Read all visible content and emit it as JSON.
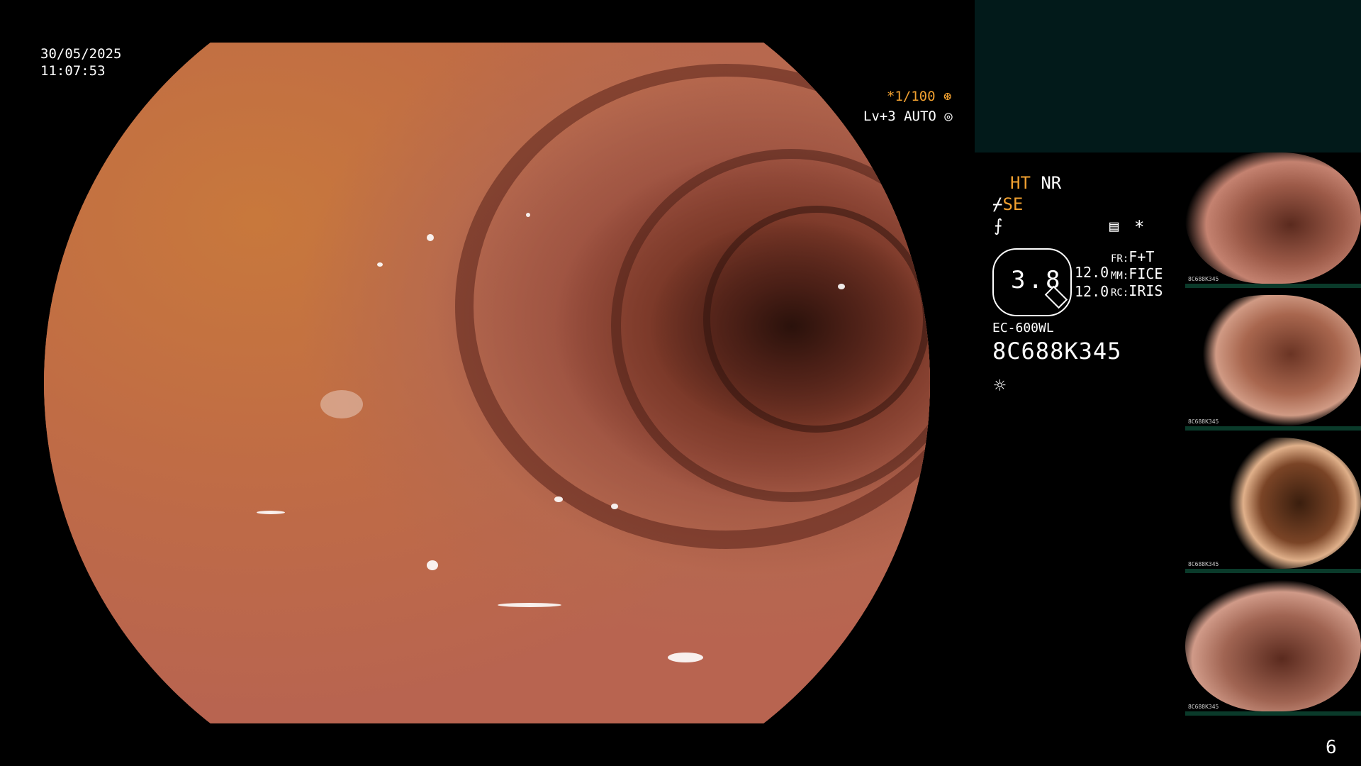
{
  "overlay": {
    "date": "30/05/2025",
    "time": "11:07:53",
    "shutter": "*1/100",
    "shutter_icon": "aperture-icon",
    "level": "Lv+3 AUTO",
    "level_icon": "iris-icon"
  },
  "panel": {
    "ht": "HT",
    "nr": "NR",
    "se": "SE",
    "se_icon": "structure-enhance-icon",
    "color_icon": "contrast-icon",
    "freeze_icon": "freeze-icon",
    "asterisk": "*",
    "zoom": "3.8",
    "values": [
      "12.0",
      "12.0"
    ],
    "labels": [
      {
        "key": "FR:",
        "value": "F+T"
      },
      {
        "key": "MM:",
        "value": "FICE"
      },
      {
        "key": "RC:",
        "value": "IRIS"
      }
    ],
    "scope_model": "EC-600WL",
    "serial": "8C688K345",
    "light_icon": "light-source-icon"
  },
  "thumbnails": [
    {
      "label": "8C688K345"
    },
    {
      "label": "8C688K345"
    },
    {
      "label": "8C688K345"
    },
    {
      "label": "8C688K345"
    }
  ],
  "page_number": "6"
}
